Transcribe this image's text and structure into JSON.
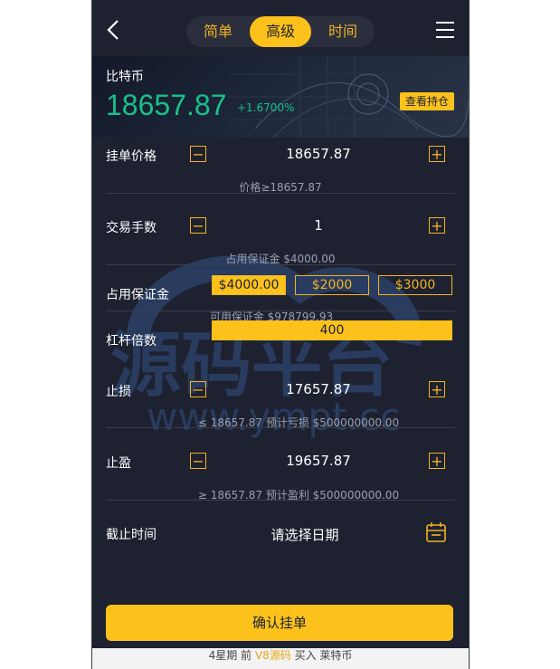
{
  "header": {
    "tabs": [
      "简单",
      "高级",
      "时间"
    ],
    "active_tab": "高级"
  },
  "ticker": {
    "name": "比特币",
    "price": "18657.87",
    "change": "+1.6700%",
    "view_position_label": "查看持仓",
    "price_color": "#19c08a"
  },
  "order_price": {
    "label": "挂单价格",
    "value": "18657.87",
    "hint": "价格≥18657.87"
  },
  "lots": {
    "label": "交易手数",
    "value": "1",
    "hint": "占用保证金 $4000.00"
  },
  "margin": {
    "label": "占用保证金",
    "options": [
      "$4000.00",
      "$2000",
      "$3000"
    ],
    "hint": "可用保证金 $978799.93"
  },
  "leverage": {
    "label": "杠杆倍数",
    "value": "400"
  },
  "stop_loss": {
    "label": "止损",
    "value": "17657.87",
    "hint": "≤ 18657.87 预计亏损 $500000000.00"
  },
  "take_profit": {
    "label": "止盈",
    "value": "19657.87",
    "hint": "≥ 18657.87 预计盈利 $500000000.00"
  },
  "deadline": {
    "label": "截止时间",
    "placeholder": "请选择日期"
  },
  "confirm_label": "确认挂单",
  "footer": {
    "prefix": "4星期 前",
    "highlight": "V8源码",
    "suffix": "买入 莱特币"
  },
  "watermark": {
    "line1": "源码平台",
    "line2": "www.ympt.cc"
  },
  "colors": {
    "accent": "#fcc21b",
    "background": "#1e2130",
    "up": "#19c08a"
  }
}
